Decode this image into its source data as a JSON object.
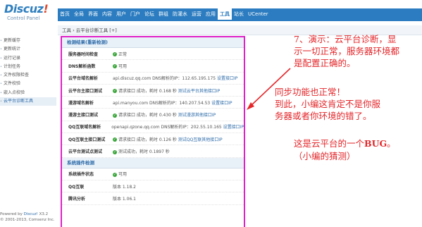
{
  "logo": {
    "name": "Discuz",
    "bang": "!",
    "subtitle": "Control Panel"
  },
  "topnav": [
    "首页",
    "全局",
    "界面",
    "内容",
    "用户",
    "门户",
    "论坛",
    "群组",
    "防灌水",
    "运营",
    "应用",
    "工具",
    "站长",
    "UCenter"
  ],
  "topnav_active": "工具",
  "breadcrumb": "工具 › 云平台诊断工具 [+]",
  "sidebar": {
    "items": [
      "更新缓存",
      "更新统计",
      "运行记录",
      "计划任务",
      "文件权限检查",
      "文件校验",
      "嵌入点校验",
      "云平台诊断工具"
    ],
    "active": "云平台诊断工具"
  },
  "powered": {
    "line1": "Powered by ",
    "brand": "Discuz!",
    "ver": " X3.2",
    "line2": "© 2001-2013, Comsenz Inc."
  },
  "section1": {
    "title": "检测结果(重新检测)",
    "rows": [
      {
        "label": "服务器时间检查",
        "ok": true,
        "text": "正常",
        "link": ""
      },
      {
        "label": "DNS解析函数",
        "ok": true,
        "text": "可用",
        "link": ""
      },
      {
        "label": "云平台域名解析",
        "ok": false,
        "text": "api.discuz.qq.com DNS解析的IP：112.65.195.175 ",
        "link": "设置接口IP"
      },
      {
        "label": "云平台主接口测试",
        "ok": true,
        "text": "请求接口 成功，耗时 0.168 秒 ",
        "link": "测试云平台其他接口IP"
      },
      {
        "label": "漫游域名解析",
        "ok": false,
        "text": "api.manyou.com DNS解析的IP：140.207.54.53 ",
        "link": "设置接口IP"
      },
      {
        "label": "漫游主接口测试",
        "ok": true,
        "text": "请求接口 成功，耗时 0.430 秒 ",
        "link": "测试漫游其他接口IP"
      },
      {
        "label": "QQ互联域名解析",
        "ok": false,
        "text": "openapi.qzone.qq.com DNS解析的IP：202.55.10.165 ",
        "link": "设置接口IP"
      },
      {
        "label": "QQ互联主接口测试",
        "ok": true,
        "text": "请求接口 成功，耗时 0.126 秒 ",
        "link": "测试QQ互联其他接口IP"
      },
      {
        "label": "云平台测试点测试",
        "ok": true,
        "text": "测试成功，耗时 0.1897 秒",
        "link": ""
      }
    ]
  },
  "section2": {
    "title": "系统插件检测",
    "rows": [
      {
        "label": "系统插件状态",
        "ok": true,
        "text": "可用",
        "link": ""
      },
      {
        "label": "QQ互联",
        "ok": false,
        "text": "版本 1.18.2",
        "link": ""
      },
      {
        "label": "腾讯分析",
        "ok": false,
        "text": "版本 1.06.1",
        "link": ""
      }
    ]
  },
  "annotations": {
    "a1": [
      "7、演示：云平台诊断，显",
      "示一切正常，服务器环境都",
      "是配置正确的。"
    ],
    "a2": [
      "同步功能也正常！",
      "到此，小编这肯定不是你服",
      "务器或者你环境的错了。"
    ],
    "a3_pre": "这是云平台的一个",
    "a3_bug": "BUG",
    "a3_post": "。",
    "a3_line2": "（小编的猜测）"
  },
  "colors": {
    "accent": "#2b7cc0",
    "annotation": "#e4262a",
    "highlight_border": "#e020c8",
    "ok": "#3aa53a"
  }
}
